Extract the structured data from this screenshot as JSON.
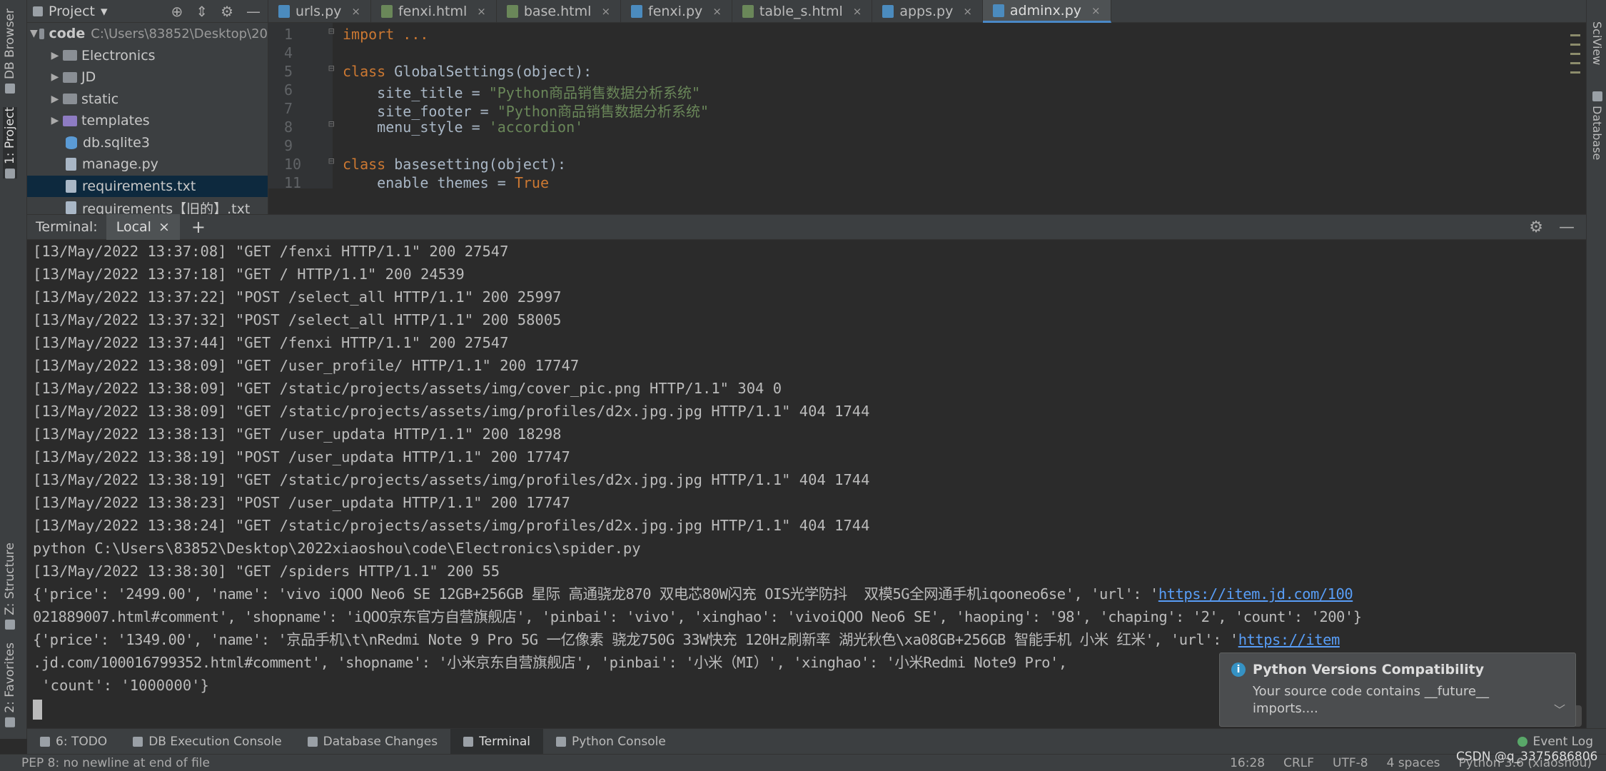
{
  "left_strip": {
    "db_browser": "DB Browser",
    "project": "1: Project",
    "structure": "Z: Structure",
    "favorites": "2: Favorites"
  },
  "right_strip": {
    "sciview": "SciView",
    "database": "Database"
  },
  "project_panel": {
    "title": "Project",
    "root_name": "code",
    "root_path": "C:\\Users\\83852\\Desktop\\20",
    "items": [
      {
        "label": "Electronics"
      },
      {
        "label": "JD"
      },
      {
        "label": "static"
      },
      {
        "label": "templates"
      },
      {
        "label": "db.sqlite3"
      },
      {
        "label": "manage.py"
      },
      {
        "label": "requirements.txt"
      },
      {
        "label": "requirements【旧的】.txt"
      }
    ]
  },
  "editor_tabs": [
    {
      "label": "urls.py"
    },
    {
      "label": "fenxi.html"
    },
    {
      "label": "base.html"
    },
    {
      "label": "fenxi.py"
    },
    {
      "label": "table_s.html"
    },
    {
      "label": "apps.py"
    },
    {
      "label": "adminx.py"
    }
  ],
  "editor": {
    "line_numbers": [
      "1",
      "4",
      "5",
      "6",
      "7",
      "8",
      "9",
      "10",
      "11"
    ],
    "l1": "import ...",
    "l5_kw": "class",
    "l5_rest": " GlobalSettings(object):",
    "l6_a": "    site_title = ",
    "l6_b": "\"Python商品销售数据分析系统\"",
    "l7_a": "    site_footer = ",
    "l7_b": "\"Python商品销售数据分析系统\"",
    "l8_a": "    menu_style = ",
    "l8_b": "'accordion'",
    "l10_kw": "class",
    "l10_rest": " basesetting(object):",
    "l11_a": "    enable_themes = ",
    "l11_b": "True"
  },
  "terminal": {
    "label": "Terminal:",
    "tab": "Local",
    "lines": [
      "[13/May/2022 13:37:08] \"GET /fenxi HTTP/1.1\" 200 27547",
      "[13/May/2022 13:37:18] \"GET / HTTP/1.1\" 200 24539",
      "[13/May/2022 13:37:22] \"POST /select_all HTTP/1.1\" 200 25997",
      "[13/May/2022 13:37:32] \"POST /select_all HTTP/1.1\" 200 58005",
      "[13/May/2022 13:37:44] \"GET /fenxi HTTP/1.1\" 200 27547",
      "[13/May/2022 13:38:09] \"GET /user_profile/ HTTP/1.1\" 200 17747",
      "[13/May/2022 13:38:09] \"GET /static/projects/assets/img/cover_pic.png HTTP/1.1\" 304 0",
      "[13/May/2022 13:38:09] \"GET /static/projects/assets/img/profiles/d2x.jpg.jpg HTTP/1.1\" 404 1744",
      "[13/May/2022 13:38:13] \"GET /user_updata HTTP/1.1\" 200 18298",
      "[13/May/2022 13:38:19] \"POST /user_updata HTTP/1.1\" 200 17747",
      "[13/May/2022 13:38:19] \"GET /static/projects/assets/img/profiles/d2x.jpg.jpg HTTP/1.1\" 404 1744",
      "[13/May/2022 13:38:23] \"POST /user_updata HTTP/1.1\" 200 17747",
      "[13/May/2022 13:38:24] \"GET /static/projects/assets/img/profiles/d2x.jpg.jpg HTTP/1.1\" 404 1744",
      "python C:\\Users\\83852\\Desktop\\2022xiaoshou\\code\\Electronics\\spider.py",
      "[13/May/2022 13:38:30] \"GET /spiders HTTP/1.1\" 200 55"
    ],
    "rec1_a": "{'price': '2499.00', 'name': 'vivo iQOO Neo6 SE 12GB+256GB 星际 高通骁龙870 双电芯80W闪充 OIS光学防抖  双模5G全网通手机iqooneo6se', 'url': '",
    "rec1_url": "https://item.jd.com/100",
    "rec1_b": "021889007.html#comment', 'shopname': 'iQOO京东官方自营旗舰店', 'pinbai': 'vivo', 'xinghao': 'vivoiQOO Neo6 SE', 'haoping': '98', 'chaping': '2', 'count': '200'}",
    "rec2_a": "{'price': '1349.00', 'name': '京品手机\\t\\nRedmi Note 9 Pro 5G 一亿像素 骁龙750G 33W快充 120Hz刷新率 湖光秋色\\xa08GB+256GB 智能手机 小米 红米', 'url': '",
    "rec2_url": "https://item",
    "rec2_b": ".jd.com/100016799352.html#comment', 'shopname': '小米京东自营旗舰店', 'pinbai': '小米（MI）', 'xinghao': '小米Redmi Note9 Pro',",
    "rec2_c": " 'count': '1000000'}"
  },
  "notification": {
    "title": "Python Versions Compatibility",
    "body_line1": "Your source code contains __future__",
    "body_line2": "imports...."
  },
  "bottom_tools": {
    "todo": "6: TODO",
    "db_exec": "DB Execution Console",
    "db_changes": "Database Changes",
    "terminal": "Terminal",
    "python_console": "Python Console",
    "event_log": "Event Log"
  },
  "status_bar": {
    "message": "PEP 8: no newline at end of file",
    "position": "16:28",
    "line_sep": "CRLF",
    "encoding": "UTF-8",
    "indent": "4 spaces",
    "interpreter": "Python 3.6 (xiaoshou)"
  },
  "watermark": "CSDN @q_3375686806",
  "colors": {
    "editor_bg": "#2b2b2b",
    "panel_bg": "#3c3f41",
    "keyword": "#cc7832",
    "string": "#6a8759",
    "link": "#589df6",
    "selection": "#0d293e"
  }
}
